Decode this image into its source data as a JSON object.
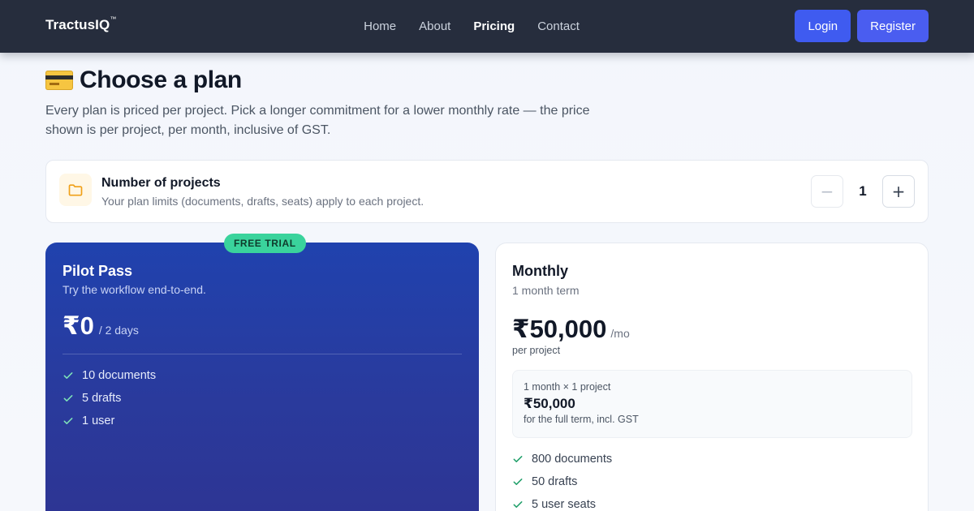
{
  "header": {
    "brand": "TractusIQ",
    "brand_mark": "™",
    "nav": [
      "Home",
      "About",
      "Pricing",
      "Contact"
    ],
    "active_nav": "Pricing",
    "login_label": "Login",
    "register_label": "Register"
  },
  "page": {
    "title": "Choose a plan",
    "title_icon": "credit-card-icon",
    "description": "Every plan is priced per project. Pick a longer commitment for a lower monthly rate — the price shown is per project, per month, inclusive of GST."
  },
  "projects": {
    "icon": "folder-icon",
    "title": "Number of projects",
    "subtitle": "Your plan limits (documents, drafts, seats) apply to each project.",
    "count": "1",
    "decrement_symbol": "−",
    "increment_symbol": "+"
  },
  "plans": [
    {
      "badge": "FREE TRIAL",
      "name": "Pilot Pass",
      "term": "Try the workflow end-to-end.",
      "price": "₹0",
      "price_suffix": "/ 2 days",
      "features": [
        "10 documents",
        "5 drafts",
        "1 user"
      ]
    },
    {
      "name": "Monthly",
      "term": "1 month term",
      "price": "₹50,000",
      "price_suffix": "/mo",
      "price_note": "per project",
      "term_line": "1 month × 1 project",
      "term_total": "₹50,000",
      "term_note": "for the full term, incl. GST",
      "features": [
        "800 documents",
        "50 drafts",
        "5 user seats"
      ]
    }
  ],
  "colors": {
    "header_bg": "#262d3d",
    "accent": "#3f5bf0",
    "pilot_card": "#2042ae",
    "trial_badge": "#3ad39c",
    "check_light": "#7ee3b8",
    "check_green": "#22a06b",
    "folder": "#f0a018"
  }
}
